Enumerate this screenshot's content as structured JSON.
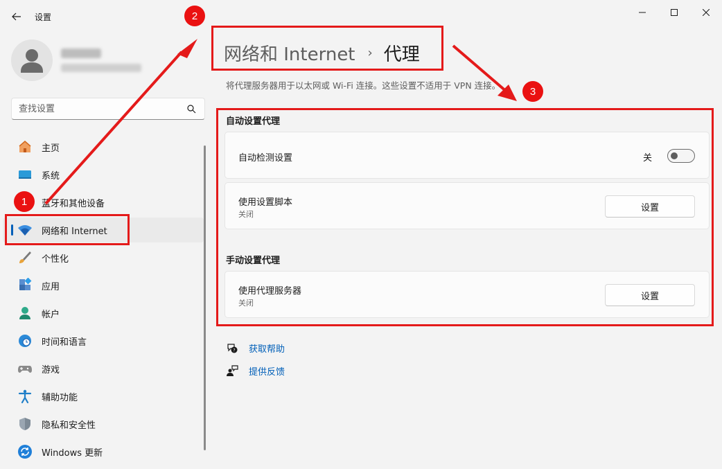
{
  "window": {
    "title": "设置"
  },
  "user": {
    "name": "",
    "email": ""
  },
  "search": {
    "placeholder": "查找设置"
  },
  "sidebar": {
    "items": [
      {
        "label": "主页",
        "icon": "home-icon"
      },
      {
        "label": "系统",
        "icon": "display-icon"
      },
      {
        "label": "蓝牙和其他设备",
        "icon": "bluetooth-icon"
      },
      {
        "label": "网络和 Internet",
        "icon": "wifi-icon",
        "active": true
      },
      {
        "label": "个性化",
        "icon": "brush-icon"
      },
      {
        "label": "应用",
        "icon": "apps-icon"
      },
      {
        "label": "帐户",
        "icon": "account-icon"
      },
      {
        "label": "时间和语言",
        "icon": "clock-globe-icon"
      },
      {
        "label": "游戏",
        "icon": "gamepad-icon"
      },
      {
        "label": "辅助功能",
        "icon": "accessibility-icon"
      },
      {
        "label": "隐私和安全性",
        "icon": "shield-icon"
      },
      {
        "label": "Windows 更新",
        "icon": "update-icon"
      }
    ]
  },
  "breadcrumb": {
    "parent": "网络和 Internet",
    "separator": "›",
    "current": "代理"
  },
  "description": "将代理服务器用于以太网或 Wi-Fi 连接。这些设置不适用于 VPN 连接。",
  "auto_proxy": {
    "title": "自动设置代理",
    "detect": {
      "label": "自动检测设置",
      "state_label": "关",
      "on": false
    },
    "script": {
      "label": "使用设置脚本",
      "sub": "关闭",
      "button": "设置"
    }
  },
  "manual_proxy": {
    "title": "手动设置代理",
    "server": {
      "label": "使用代理服务器",
      "sub": "关闭",
      "button": "设置"
    }
  },
  "links": {
    "help": "获取帮助",
    "feedback": "提供反馈"
  },
  "annotations": {
    "steps": [
      "1",
      "2",
      "3"
    ],
    "color": "#e41a1a"
  },
  "colors": {
    "accent": "#005fb8",
    "background": "#f3f3f3"
  }
}
